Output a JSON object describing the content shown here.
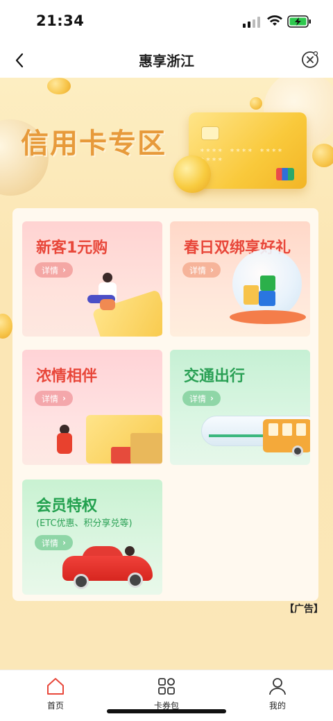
{
  "status_bar": {
    "time": "21:34",
    "battery_charging": true,
    "battery_color": "#2dc84d"
  },
  "nav": {
    "title": "惠享浙江",
    "back_icon": "chevron-left-icon",
    "close_icon": "close-circle-icon"
  },
  "banner": {
    "title": "信用卡专区",
    "card_number": "**** **** **** ****"
  },
  "tiles": [
    {
      "title": "新客1元购",
      "button": "详情",
      "color": "#e8473a"
    },
    {
      "title": "春日双绑享好礼",
      "button": "详情",
      "color": "#e8473a"
    },
    {
      "title": "浓情相伴",
      "button": "详情",
      "color": "#e8473a"
    },
    {
      "title": "交通出行",
      "button": "详情",
      "color": "#2aa055"
    },
    {
      "title": "会员特权",
      "subtitle": "(ETC优惠、积分享兑等)",
      "button": "详情",
      "color": "#22a04e"
    }
  ],
  "ad_label": "【广告】",
  "tab_bar": {
    "items": [
      {
        "label": "首页",
        "icon": "home-icon",
        "active": true,
        "active_color": "#e8473a"
      },
      {
        "label": "卡券包",
        "icon": "grid-icon",
        "active": false
      },
      {
        "label": "我的",
        "icon": "user-icon",
        "active": false
      }
    ]
  }
}
